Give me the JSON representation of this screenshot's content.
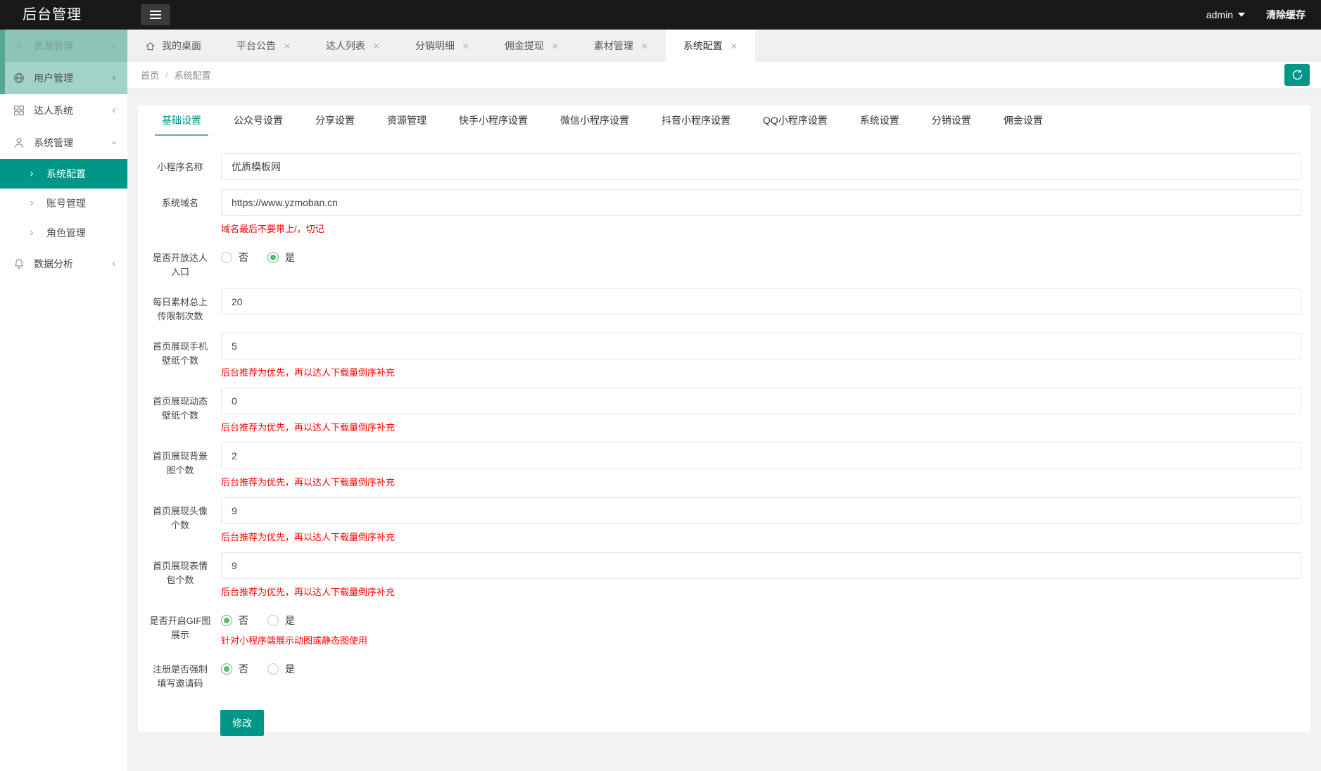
{
  "colors": {
    "accent": "#009688",
    "tab_underline": "#5FB878",
    "hint_text": "#ff0000",
    "header_bg": "#191919"
  },
  "header": {
    "title": "后台管理",
    "user": "admin",
    "user_caret_icon": "chevron-down-icon",
    "clear_cache_label": "清除缓存",
    "menu_toggle_icon": "hamburger-icon"
  },
  "sidebar": {
    "items": [
      {
        "id": "ziyuan-guanli",
        "label": "资源管理",
        "icon": "user-icon",
        "chevron": "left",
        "state": "t1"
      },
      {
        "id": "yonghu-guanli",
        "label": "用户管理",
        "icon": "globe-icon",
        "chevron": "left",
        "state": "t2"
      },
      {
        "id": "daren-xitong",
        "label": "达人系统",
        "icon": "grid-icon",
        "chevron": "left"
      },
      {
        "id": "xitong-guanli",
        "label": "系统管理",
        "icon": "user-icon",
        "chevron": "down",
        "expanded": true,
        "children": [
          {
            "id": "xitong-peizhi",
            "label": "系统配置",
            "active": true
          },
          {
            "id": "zhanghao-guanli",
            "label": "账号管理",
            "active": false
          },
          {
            "id": "juese-guanli",
            "label": "角色管理",
            "active": false
          }
        ]
      },
      {
        "id": "shuju-fenxi",
        "label": "数据分析",
        "icon": "bell-icon",
        "chevron": "left"
      }
    ]
  },
  "workspace_tabs": [
    {
      "id": "wodezhuomian",
      "label": "我的桌面",
      "icon": "home-icon",
      "closable": false,
      "active": false
    },
    {
      "id": "pingtaigonggao",
      "label": "平台公告",
      "closable": true,
      "active": false
    },
    {
      "id": "darenliebiao",
      "label": "达人列表",
      "closable": true,
      "active": false
    },
    {
      "id": "fenxiaomingxi",
      "label": "分销明细",
      "closable": true,
      "active": false
    },
    {
      "id": "yongjintixian",
      "label": "佣金提现",
      "closable": true,
      "active": false
    },
    {
      "id": "sucaiguanli",
      "label": "素材管理",
      "closable": true,
      "active": false
    },
    {
      "id": "xitongpeizhi",
      "label": "系统配置",
      "closable": true,
      "active": true
    }
  ],
  "breadcrumb": {
    "home": "首页",
    "separator": "/",
    "current": "系统配置",
    "refresh_icon": "refresh-icon"
  },
  "settings_tabs": [
    {
      "label": "基础设置",
      "active": true
    },
    {
      "label": "公众号设置",
      "active": false
    },
    {
      "label": "分享设置",
      "active": false
    },
    {
      "label": "资源管理",
      "active": false
    },
    {
      "label": "快手小程序设置",
      "active": false
    },
    {
      "label": "微信小程序设置",
      "active": false
    },
    {
      "label": "抖音小程序设置",
      "active": false
    },
    {
      "label": "QQ小程序设置",
      "active": false
    },
    {
      "label": "系统设置",
      "active": false
    },
    {
      "label": "分销设置",
      "active": false
    },
    {
      "label": "佣金设置",
      "active": false
    }
  ],
  "form": {
    "rows": [
      {
        "type": "input",
        "label": "小程序名称",
        "value": "优质模板网"
      },
      {
        "type": "input",
        "label": "系统域名",
        "value": "https://www.yzmoban.cn",
        "hint": "域名最后不要带上/，切记"
      },
      {
        "type": "radio",
        "label": "是否开放达人入口",
        "options": [
          "否",
          "是"
        ],
        "selected": 1
      },
      {
        "type": "input",
        "label": "每日素材总上传限制次数",
        "value": "20"
      },
      {
        "type": "input",
        "label": "首页展现手机壁纸个数",
        "value": "5",
        "hint": "后台推荐为优先，再以达人下载量倒序补充"
      },
      {
        "type": "input",
        "label": "首页展现动态壁纸个数",
        "value": "0",
        "hint": "后台推荐为优先，再以达人下载量倒序补充"
      },
      {
        "type": "input",
        "label": "首页展现背景图个数",
        "value": "2",
        "hint": "后台推荐为优先，再以达人下载量倒序补充"
      },
      {
        "type": "input",
        "label": "首页展现头像个数",
        "value": "9",
        "hint": "后台推荐为优先，再以达人下载量倒序补充"
      },
      {
        "type": "input",
        "label": "首页展现表情包个数",
        "value": "9",
        "hint": "后台推荐为优先，再以达人下载量倒序补充"
      },
      {
        "type": "radio",
        "label": "是否开启GIF图展示",
        "options": [
          "否",
          "是"
        ],
        "selected": 0,
        "hint": "针对小程序端展示动图或静态图使用"
      },
      {
        "type": "radio",
        "label": "注册是否强制填写邀请码",
        "options": [
          "否",
          "是"
        ],
        "selected": 0
      }
    ],
    "submit_label": "修改"
  }
}
